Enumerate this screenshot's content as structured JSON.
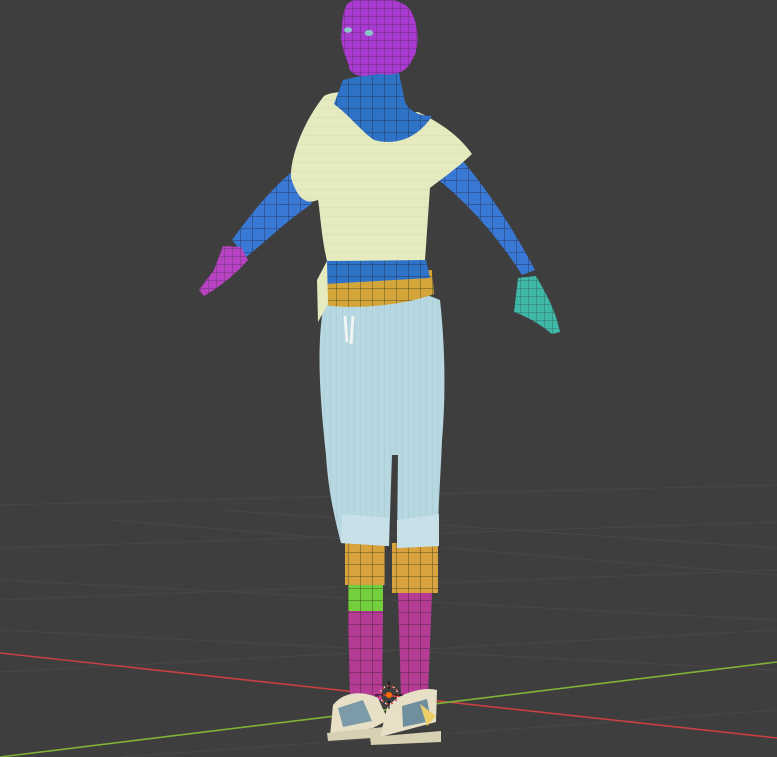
{
  "viewport": {
    "background": "#3e3e3e",
    "grid_color": "#4a4a4a",
    "x_axis_color": "#c8403f",
    "y_axis_color": "#7fb236"
  },
  "model": {
    "colors": {
      "head": "#a93bd0",
      "neck": "#2f73c9",
      "torso_band": "#2f73c9",
      "hip_band": "#d4a63a",
      "shirt": "#e6ebbf",
      "arm": "#3a78d6",
      "left_hand": "#b843c2",
      "right_hand": "#3fb8a8",
      "pants": "#b7d8e1",
      "sock_upper": "#d8a33c",
      "sock_green": "#74cf3d",
      "sock_lower": "#b53b95",
      "shoe": "#e7e0c7"
    }
  },
  "icons": {
    "origin": "3d-cursor-icon"
  }
}
